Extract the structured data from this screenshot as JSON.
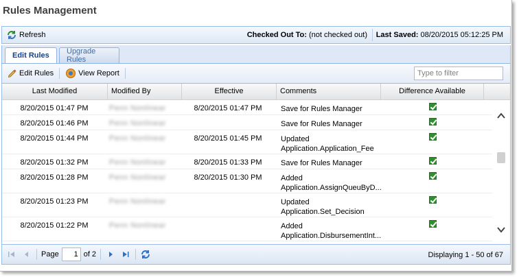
{
  "window": {
    "title": "Rules Management"
  },
  "topbar": {
    "refresh_label": "Refresh",
    "checked_out_label": "Checked Out To:",
    "checked_out_value": "(not checked out)",
    "last_saved_label": "Last Saved:",
    "last_saved_value": "08/20/2015 05:12:25 PM"
  },
  "tabs": [
    {
      "label": "Edit Rules",
      "active": true
    },
    {
      "label": "Upgrade Rules",
      "active": false
    }
  ],
  "toolbar": {
    "edit_rules_label": "Edit Rules",
    "view_report_label": "View Report",
    "filter_placeholder": "Type to filter"
  },
  "grid": {
    "columns": [
      "Last Modified",
      "Modified By",
      "Effective",
      "Comments",
      "Difference Available"
    ],
    "rows": [
      {
        "last_modified": "8/20/2015 01:47 PM",
        "modified_by": "Penn Nonlinear",
        "effective": "8/20/2015 01:47 PM",
        "comment_line1": "Save for Rules Manager",
        "comment_line2": "",
        "difference": true
      },
      {
        "last_modified": "8/20/2015 01:46 PM",
        "modified_by": "Penn Nonlinear",
        "effective": "",
        "comment_line1": "Save for Rules Manager",
        "comment_line2": "",
        "difference": true
      },
      {
        "last_modified": "8/20/2015 01:44 PM",
        "modified_by": "Penn Nonlinear",
        "effective": "8/20/2015 01:45 PM",
        "comment_line1": "Updated",
        "comment_line2": "Application.Application_Fee",
        "difference": true
      },
      {
        "last_modified": "8/20/2015 01:32 PM",
        "modified_by": "Penn Nonlinear",
        "effective": "8/20/2015 01:33 PM",
        "comment_line1": "Save for Rules Manager",
        "comment_line2": "",
        "difference": true
      },
      {
        "last_modified": "8/20/2015 01:28 PM",
        "modified_by": "Penn Nonlinear",
        "effective": "8/20/2015 01:30 PM",
        "comment_line1": "Added",
        "comment_line2": "Application.AssignQueuByD...",
        "difference": true
      },
      {
        "last_modified": "8/20/2015 01:23 PM",
        "modified_by": "Penn Nonlinear",
        "effective": "",
        "comment_line1": "Updated",
        "comment_line2": "Application.Set_Decision",
        "difference": true
      },
      {
        "last_modified": "8/20/2015 01:22 PM",
        "modified_by": "Penn Nonlinear",
        "effective": "",
        "comment_line1": "Added",
        "comment_line2": "Application.DisbursementInt...",
        "difference": true
      }
    ]
  },
  "pager": {
    "page_label": "Page",
    "current_page": "1",
    "of_label": "of 2",
    "displaying": "Displaying 1 - 50 of 67"
  },
  "colors": {
    "border": "#99bbe8",
    "tab_active_text": "#15428b",
    "check_green": "#2f8f2f"
  }
}
